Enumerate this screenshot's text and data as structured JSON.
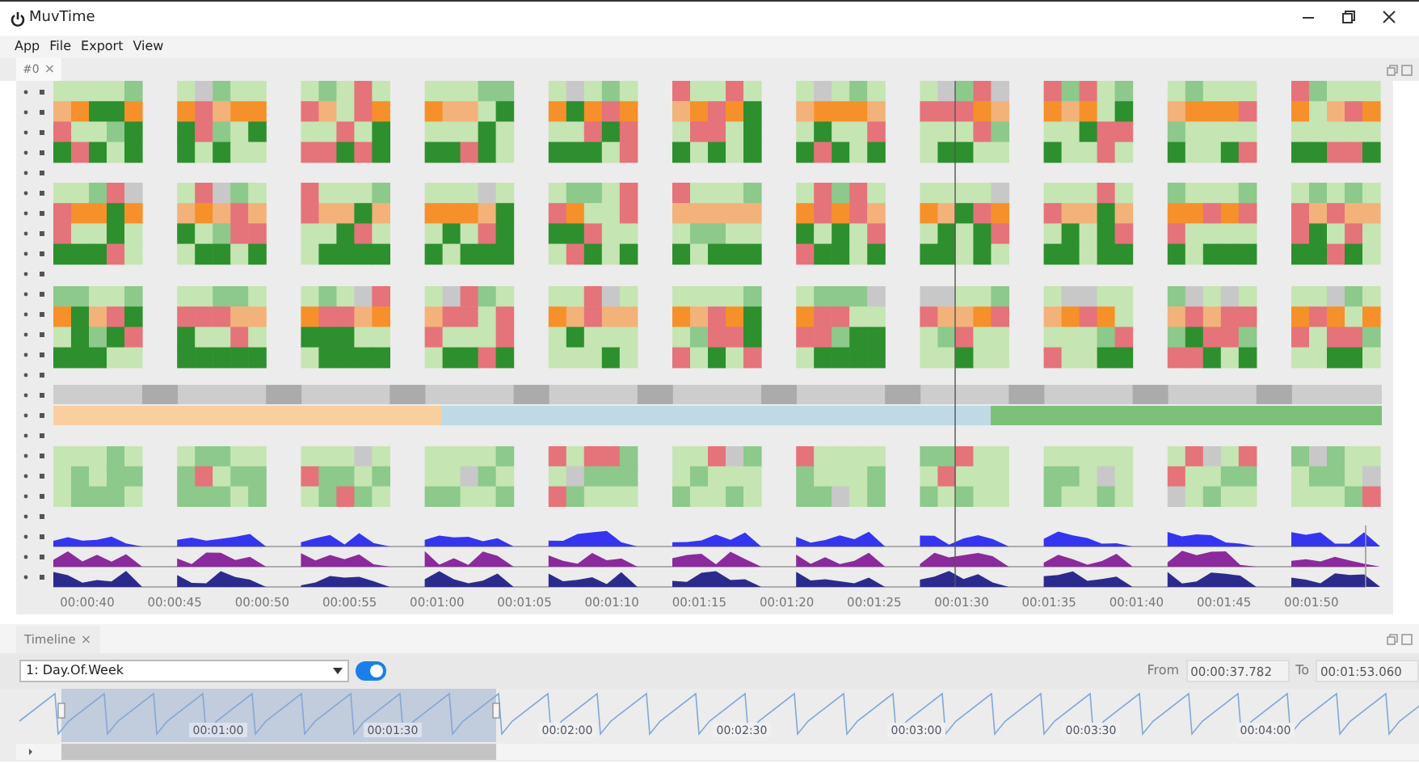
{
  "window": {
    "title": "MuvTime"
  },
  "menu": [
    "App",
    "File",
    "Export",
    "View"
  ],
  "document_tab": {
    "label": "#0",
    "close": "×"
  },
  "time_axis": [
    "00:00:40",
    "00:00:45",
    "00:00:50",
    "00:00:55",
    "00:01:00",
    "00:01:05",
    "00:01:10",
    "00:01:15",
    "00:01:20",
    "00:01:25",
    "00:01:30",
    "00:01:35",
    "00:01:40",
    "00:01:45",
    "00:01:50"
  ],
  "timeline": {
    "tab": {
      "label": "Timeline",
      "close": "×"
    },
    "dropdown": {
      "value": "1: Day.Of.Week"
    },
    "toggle": {
      "on": true
    },
    "from_label": "From",
    "from_value": "00:00:37.782",
    "to_label": "To",
    "to_value": "00:01:53.060",
    "overview_labels": [
      "00:01:00",
      "00:01:30",
      "00:02:00",
      "00:02:30",
      "00:03:00",
      "00:03:30",
      "00:04:00"
    ]
  }
}
